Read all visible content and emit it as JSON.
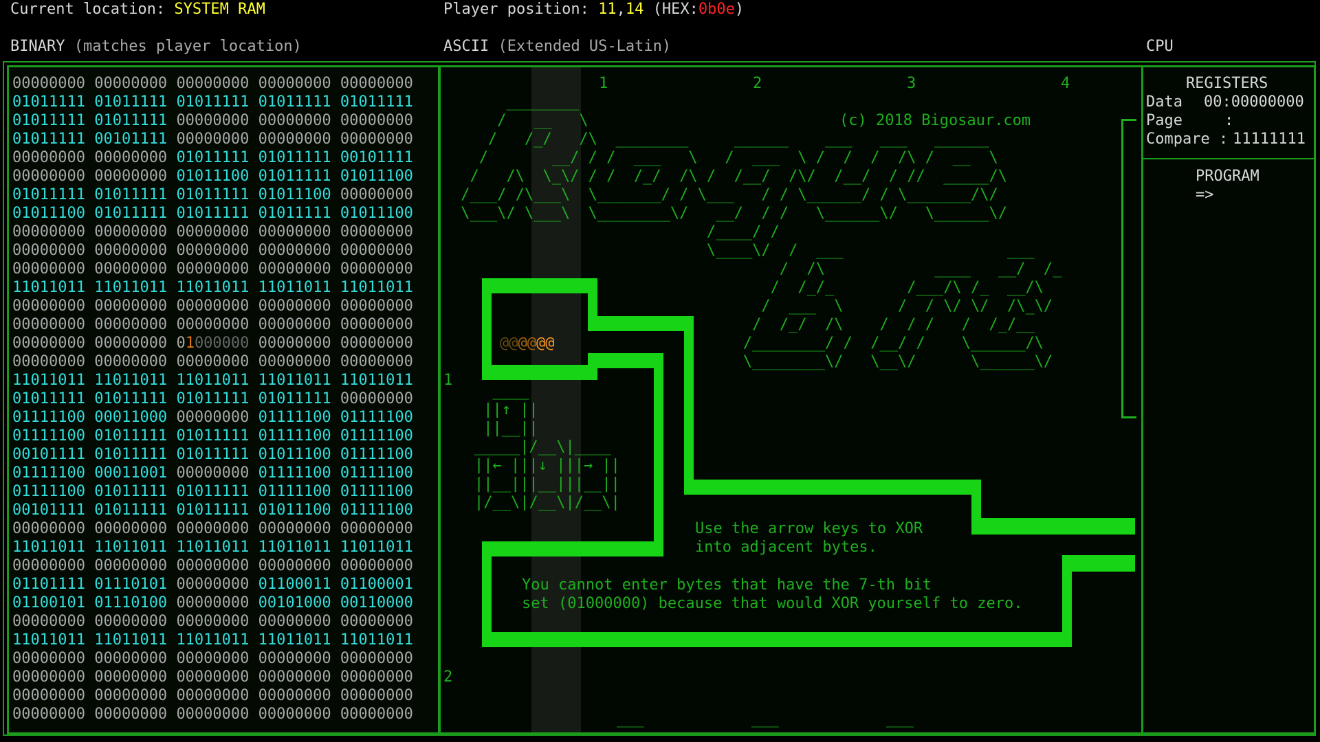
{
  "header": {
    "location_label": "Current location: ",
    "location_value": "SYSTEM RAM",
    "position_label": "Player position: ",
    "position_x": "11",
    "position_comma": ",",
    "position_y": "14",
    "hex_open": " (HEX:",
    "hex_value": "0b0e",
    "hex_close": ")"
  },
  "sections": {
    "binary_title": "BINARY",
    "binary_sub": " (matches player location)",
    "ascii_title": "ASCII",
    "ascii_sub": " (Extended US-Latin)",
    "cpu_title": "CPU"
  },
  "binary": {
    "rows": [
      [
        "00000000",
        "00000000",
        "00000000",
        "00000000",
        "00000000"
      ],
      [
        "01011111",
        "01011111",
        "01011111",
        "01011111",
        "01011111"
      ],
      [
        "01011111",
        "01011111",
        "00000000",
        "00000000",
        "00000000"
      ],
      [
        "01011111",
        "00101111",
        "00000000",
        "00000000",
        "00000000"
      ],
      [
        "00000000",
        "00000000",
        "01011111",
        "01011111",
        "00101111"
      ],
      [
        "00000000",
        "00000000",
        "01011100",
        "01011111",
        "01011100"
      ],
      [
        "01011111",
        "01011111",
        "01011111",
        "01011100",
        "00000000"
      ],
      [
        "01011100",
        "01011111",
        "01011111",
        "01011111",
        "01011100"
      ],
      [
        "00000000",
        "00000000",
        "00000000",
        "00000000",
        "00000000"
      ],
      [
        "00000000",
        "00000000",
        "00000000",
        "00000000",
        "00000000"
      ],
      [
        "00000000",
        "00000000",
        "00000000",
        "00000000",
        "00000000"
      ],
      [
        "11011011",
        "11011011",
        "11011011",
        "11011011",
        "11011011"
      ],
      [
        "00000000",
        "00000000",
        "00000000",
        "00000000",
        "00000000"
      ],
      [
        "00000000",
        "00000000",
        "00000000",
        "00000000",
        "00000000"
      ],
      [
        "00000000",
        "00000000",
        "01000000",
        "00000000",
        "00000000"
      ],
      [
        "00000000",
        "00000000",
        "00000000",
        "00000000",
        "00000000"
      ],
      [
        "11011011",
        "11011011",
        "11011011",
        "11011011",
        "11011011"
      ],
      [
        "01011111",
        "01011111",
        "01011111",
        "01011111",
        "00000000"
      ],
      [
        "01111100",
        "00011000",
        "00000000",
        "01111100",
        "01111100"
      ],
      [
        "01111100",
        "01011111",
        "01011111",
        "01111100",
        "01111100"
      ],
      [
        "00101111",
        "01011111",
        "01011111",
        "01011100",
        "01111100"
      ],
      [
        "01111100",
        "00011001",
        "00000000",
        "01111100",
        "01111100"
      ],
      [
        "01111100",
        "01011111",
        "01011111",
        "01111100",
        "01111100"
      ],
      [
        "00101111",
        "01011111",
        "01011111",
        "01011100",
        "01111100"
      ],
      [
        "00000000",
        "00000000",
        "00000000",
        "00000000",
        "00000000"
      ],
      [
        "11011011",
        "11011011",
        "11011011",
        "11011011",
        "11011011"
      ],
      [
        "00000000",
        "00000000",
        "00000000",
        "00000000",
        "00000000"
      ],
      [
        "01101111",
        "01110101",
        "00000000",
        "01100011",
        "01100001"
      ],
      [
        "01100101",
        "01110100",
        "00000000",
        "00101000",
        "00110000"
      ],
      [
        "00000000",
        "00000000",
        "00000000",
        "00000000",
        "00000000"
      ],
      [
        "11011011",
        "11011011",
        "11011011",
        "11011011",
        "11011011"
      ],
      [
        "00000000",
        "00000000",
        "00000000",
        "00000000",
        "00000000"
      ],
      [
        "00000000",
        "00000000",
        "00000000",
        "00000000",
        "00000000"
      ],
      [
        "00000000",
        "00000000",
        "00000000",
        "00000000",
        "00000000"
      ],
      [
        "00000000",
        "00000000",
        "00000000",
        "00000000",
        "00000000"
      ]
    ],
    "player_row": 14,
    "player_col": 2
  },
  "ascii": {
    "col_markers": [
      "1",
      "2",
      "3",
      "4"
    ],
    "row_markers": [
      "1",
      "2"
    ],
    "copyright": "(c) 2018 Bigosaur.com",
    "logo_lines": [
      "      ________",
      "     /   __   \\",
      "    /   /_/   /\\  ________     ______    ___   ___   ______",
      "   /       __/ / /  ___   \\   /  ___  \\ /  /  /  /\\ /  __  \\",
      "  /   /\\  \\_\\/ / /  /_/  /\\ /  /__/  /\\/  /__/  / //  _____/\\",
      " /___/ /\\___\\  \\_______/ / \\___   / / \\______/ / \\_______/\\/",
      " \\___\\/ \\___\\  \\________\\/   __/  / /   \\______\\/   \\______\\/",
      "                            /____/ /",
      "                            \\____\\/  /  ___                  ___",
      "                                    /  /\\            ____   __/  /_",
      "                                   /  /_/_        /___/\\ /_  __/\\",
      "                                  /  ___  \\      /  / \\/ \\/  /\\_\\/",
      "                                 /  /_/  /\\    /  / /   /  /_/__",
      "                                /________/ /  /__/ /    \\______/\\",
      "                                \\________\\/   \\__\\/      \\______\\/"
    ],
    "player_glyphs": "@@@@@@",
    "door_lines": [
      "  ____",
      " ||↑ ||",
      " ||__||",
      "_____|/__\\|____",
      "||← |||↓ |||→ ||",
      "||__|||__|||__||",
      "|/__\\|/__\\|/__\\|"
    ],
    "hint1_line1": "Use the arrow keys to XOR",
    "hint1_line2": "into adjacent bytes.",
    "hint2_line1": "You cannot enter bytes that have the 7-th bit",
    "hint2_line2": "set (01000000) because that would XOR yourself to zero.",
    "bottom_marks": [
      "___",
      "___",
      "___"
    ]
  },
  "cpu": {
    "registers_title": "REGISTERS",
    "data_label": "Data",
    "data_value": "00:00000000",
    "page_label": "Page",
    "page_value": ":",
    "compare_label": "Compare :",
    "compare_value": "11111111",
    "program_title": "PROGRAM",
    "program_pointer": "=>"
  },
  "colors": {
    "wall": "#17d417",
    "ascii_text": "#1fae1f",
    "highlight": "#33dddd",
    "accent_yellow": "#ffff33",
    "hex_red": "#ff2222",
    "player_orange": "#ff9922"
  }
}
